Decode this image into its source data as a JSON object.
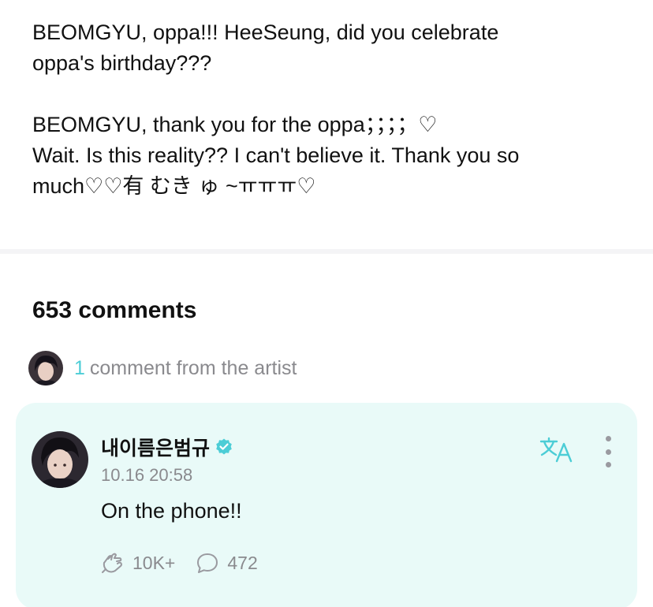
{
  "post": {
    "paragraph1": "BEOMGYU, oppa!!! HeeSeung, did you celebrate\noppa's birthday???",
    "paragraph2": "BEOMGYU, thank you for the oppa；；；；♡\nWait. Is this reality?? I can't believe it. Thank you so\nmuch♡♡有 むき ゅ ~ㅠㅠㅠ♡"
  },
  "comments": {
    "count_label": "653 comments",
    "artist_count": "1",
    "artist_label": "comment from the artist"
  },
  "artist_comment": {
    "author": "내이름은범규",
    "timestamp": "10.16 20:58",
    "text": "On the phone!!",
    "likes": "10K+",
    "replies": "472"
  },
  "icons": {
    "verified": "verified-badge-icon",
    "translate": "translate-icon",
    "more": "more-vertical-icon",
    "like": "like-hands-icon",
    "reply": "reply-bubble-icon"
  },
  "colors": {
    "accent": "#4ccdd6",
    "card_background": "#e9faf8",
    "muted_text": "#8a8a8e"
  }
}
